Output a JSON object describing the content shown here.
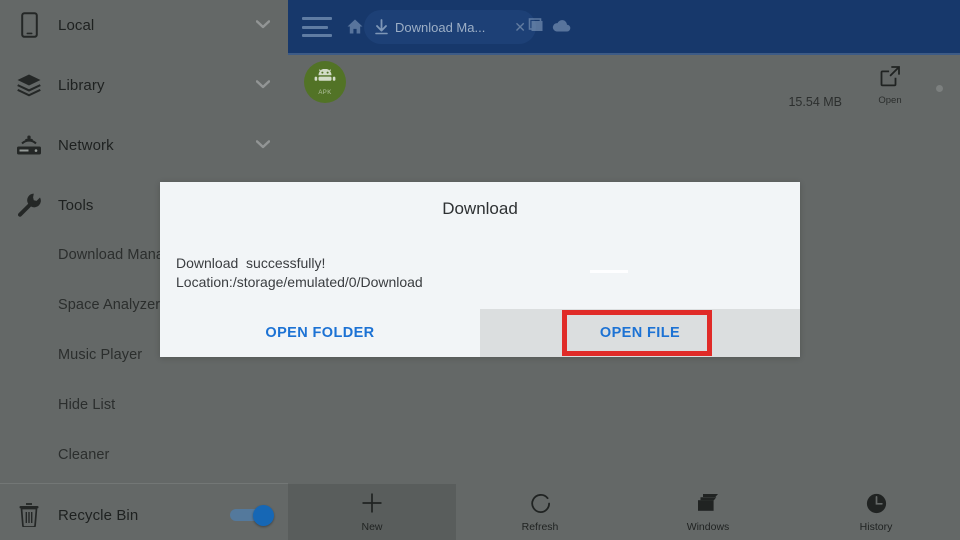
{
  "app": {
    "accent_blue": "#17386b",
    "link_blue": "#1c72d4",
    "annotation_red": "#e02b28",
    "scrim": "#646867",
    "apk_green": "#527326"
  },
  "drawer": {
    "items": [
      {
        "label": "Local",
        "icon": "phone-icon",
        "type": "group",
        "chevron": true
      },
      {
        "label": "Library",
        "icon": "layers-icon",
        "type": "group",
        "chevron": true
      },
      {
        "label": "Network",
        "icon": "router-icon",
        "type": "group",
        "chevron": true
      },
      {
        "label": "Tools",
        "icon": "wrench-icon",
        "type": "group",
        "chevron": false
      },
      {
        "label": "Download Mana",
        "icon": "",
        "type": "sub",
        "chevron": false
      },
      {
        "label": "Space Analyzer",
        "icon": "",
        "type": "sub",
        "chevron": false
      },
      {
        "label": "Music Player",
        "icon": "",
        "type": "sub",
        "chevron": false
      },
      {
        "label": "Hide List",
        "icon": "",
        "type": "sub",
        "chevron": false
      },
      {
        "label": "Cleaner",
        "icon": "",
        "type": "sub",
        "chevron": false
      }
    ],
    "footer": {
      "label": "Recycle Bin",
      "icon": "trash-icon",
      "toggle_on": true
    }
  },
  "topbar": {
    "menu_icon": "hamburger-icon",
    "home_icon": "home-icon",
    "windows_icon": "windows-icon",
    "cloud_icon": "cloud-icon",
    "tab": {
      "icon": "download-arrow-icon",
      "label": "Download Ma...",
      "close_icon": "close-icon"
    }
  },
  "file_row": {
    "badge": {
      "icon": "android-robot-icon",
      "type_text": "APK"
    },
    "size": "15.54 MB",
    "action": {
      "label": "Open",
      "icon": "open-external-icon"
    },
    "more_icon": "more-dot-icon"
  },
  "bottom_nav": {
    "items": [
      {
        "label": "New",
        "icon": "plus-icon",
        "active": true
      },
      {
        "label": "Refresh",
        "icon": "refresh-icon",
        "active": false
      },
      {
        "label": "Windows",
        "icon": "windows-icon",
        "active": false
      },
      {
        "label": "History",
        "icon": "clock-icon",
        "active": false
      }
    ]
  },
  "dialog": {
    "title": "Download",
    "message_line1": "Download  successfully!",
    "message_line2": "Location:/storage/emulated/0/Download",
    "buttons": {
      "open_folder": "OPEN FOLDER",
      "open_file": "OPEN FILE"
    },
    "highlighted_button": "OPEN FILE"
  }
}
